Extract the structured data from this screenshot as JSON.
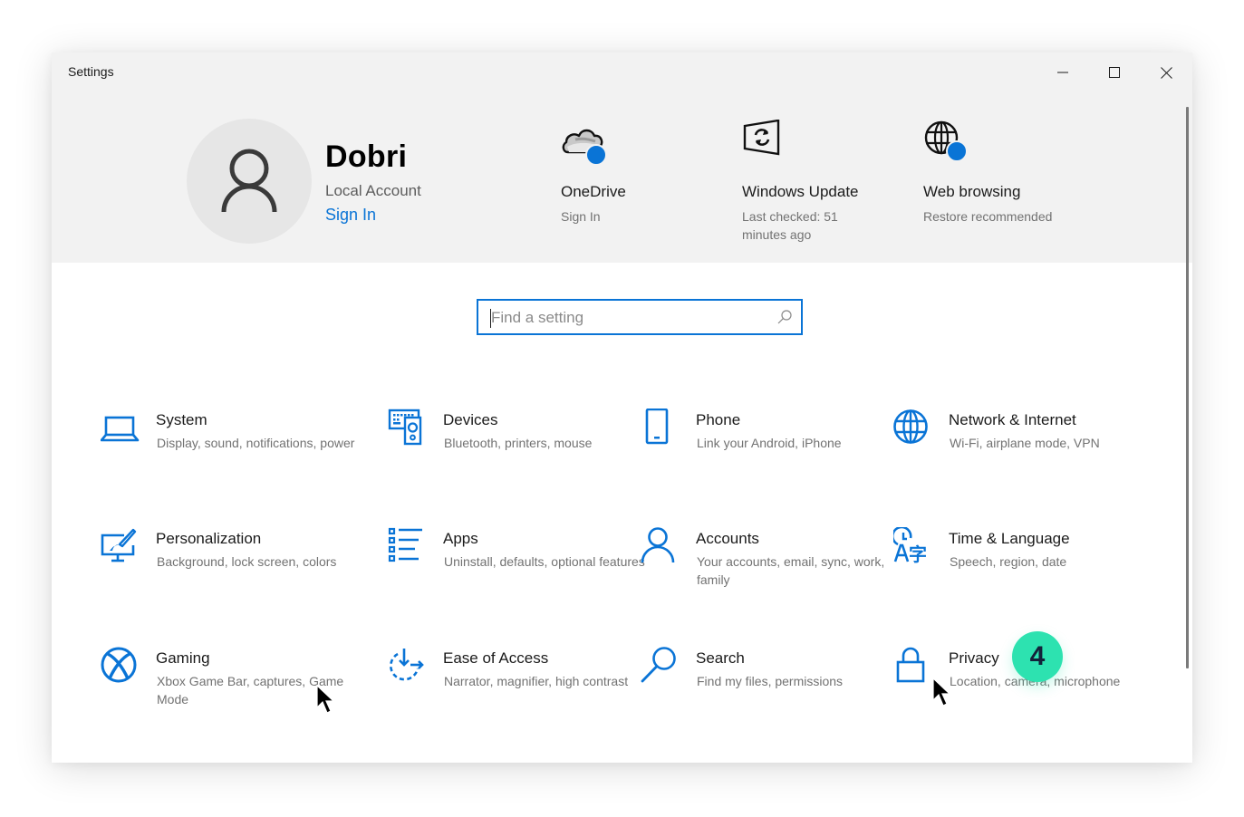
{
  "window": {
    "title": "Settings",
    "controls": {
      "minimize": "minimize-icon",
      "maximize": "maximize-icon",
      "close": "close-icon"
    }
  },
  "header": {
    "user": {
      "name": "Dobri",
      "account_type": "Local Account",
      "sign_in_label": "Sign In",
      "avatar_icon": "person-icon"
    },
    "quick_links": [
      {
        "icon": "onedrive-cloud-icon",
        "title": "OneDrive",
        "subtitle": "Sign In",
        "status_dot": true
      },
      {
        "icon": "windows-update-icon",
        "title": "Windows Update",
        "subtitle": "Last checked: 51 minutes ago",
        "status_dot": false
      },
      {
        "icon": "globe-icon",
        "title": "Web browsing",
        "subtitle": "Restore recommended",
        "status_dot": true
      }
    ]
  },
  "search": {
    "placeholder": "Find a setting",
    "value": ""
  },
  "categories": [
    {
      "icon": "laptop-icon",
      "title": "System",
      "subtitle": "Display, sound, notifications, power"
    },
    {
      "icon": "devices-icon",
      "title": "Devices",
      "subtitle": "Bluetooth, printers, mouse"
    },
    {
      "icon": "phone-icon",
      "title": "Phone",
      "subtitle": "Link your Android, iPhone"
    },
    {
      "icon": "globe-icon",
      "title": "Network & Internet",
      "subtitle": "Wi-Fi, airplane mode, VPN"
    },
    {
      "icon": "paintbrush-icon",
      "title": "Personalization",
      "subtitle": "Background, lock screen, colors"
    },
    {
      "icon": "apps-list-icon",
      "title": "Apps",
      "subtitle": "Uninstall, defaults, optional features"
    },
    {
      "icon": "person-icon",
      "title": "Accounts",
      "subtitle": "Your accounts, email, sync, work, family"
    },
    {
      "icon": "time-language-icon",
      "title": "Time & Language",
      "subtitle": "Speech, region, date"
    },
    {
      "icon": "xbox-icon",
      "title": "Gaming",
      "subtitle": "Xbox Game Bar, captures, Game Mode"
    },
    {
      "icon": "ease-of-access-icon",
      "title": "Ease of Access",
      "subtitle": "Narrator, magnifier, high contrast"
    },
    {
      "icon": "search-icon",
      "title": "Search",
      "subtitle": "Find my files, permissions"
    },
    {
      "icon": "lock-icon",
      "title": "Privacy",
      "subtitle": "Location, camera, microphone"
    }
  ],
  "annotation": {
    "step_badge": "4"
  },
  "colors": {
    "accent": "#0a74d6",
    "header_bg": "#f2f2f2",
    "badge": "#2de2b0",
    "badge_text": "#13223a",
    "status_dot": "#0a74d6"
  }
}
